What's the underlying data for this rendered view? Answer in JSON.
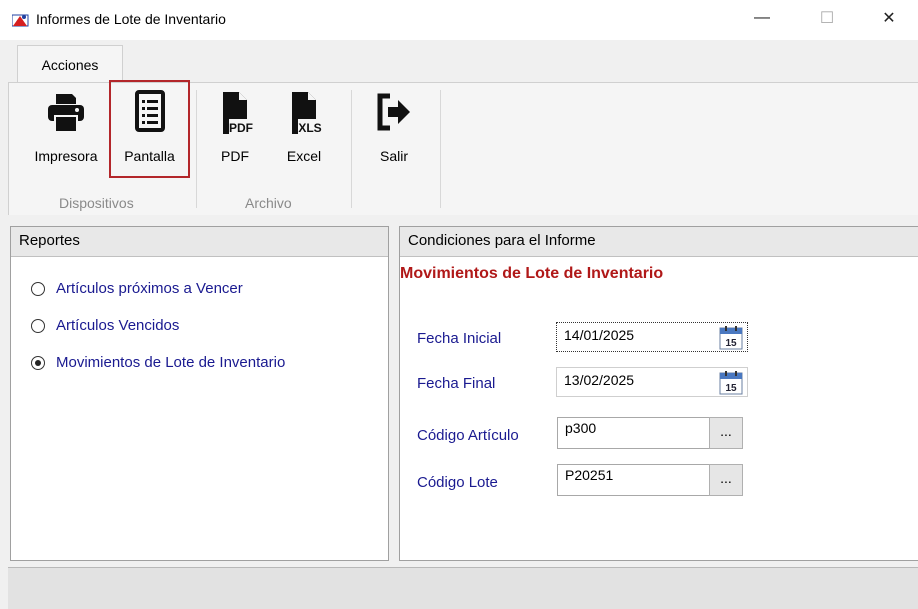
{
  "window": {
    "title": "Informes de Lote de Inventario",
    "minimize_glyph": "—",
    "maximize_glyph": "☐",
    "close_glyph": "✕"
  },
  "ribbon": {
    "tab_label": "Acciones",
    "groups": {
      "dispositivos": "Dispositivos",
      "archivo": "Archivo"
    },
    "buttons": {
      "impresora": "Impresora",
      "pantalla": "Pantalla",
      "pdf": "PDF",
      "excel": "Excel",
      "salir": "Salir"
    },
    "icon_text": {
      "pdf": "PDF",
      "xls": "XLS"
    }
  },
  "reportes": {
    "header": "Reportes",
    "options": [
      {
        "label": "Artículos próximos a Vencer",
        "selected": false
      },
      {
        "label": "Artículos Vencidos",
        "selected": false
      },
      {
        "label": "Movimientos de Lote de Inventario",
        "selected": true
      }
    ]
  },
  "condiciones": {
    "header": "Condiciones para el Informe",
    "report_title": "Movimientos de Lote de Inventario",
    "fecha_inicial_label": "Fecha Inicial",
    "fecha_inicial_value": "14/01/2025",
    "fecha_final_label": "Fecha Final",
    "fecha_final_value": "13/02/2025",
    "codigo_articulo_label": "Código Artículo",
    "codigo_articulo_value": "p300",
    "codigo_lote_label": "Código Lote",
    "codigo_lote_value": "P20251",
    "browse_label": "...",
    "calendar_day": "15"
  },
  "colors": {
    "accent_red": "#b01818",
    "label_blue": "#1a1a90",
    "highlight_border": "#b3262a"
  }
}
